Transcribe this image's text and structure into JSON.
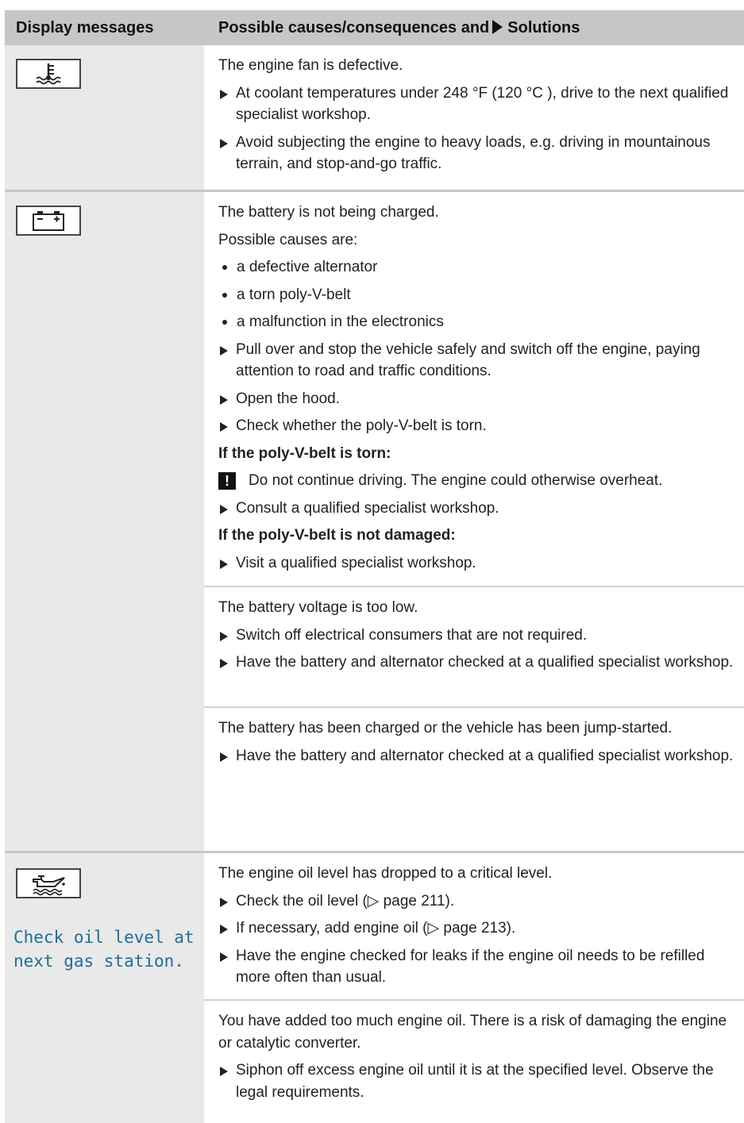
{
  "header": {
    "col1": "Display messages",
    "col2": "Possible causes/consequences and",
    "col2_solutions": "Solutions"
  },
  "icons": {
    "coolant": "coolant-temperature-icon",
    "battery": "battery-icon",
    "oil": "oil-can-icon"
  },
  "rows": {
    "fan": {
      "text": "The engine fan is defective.",
      "b1": "At coolant temperatures under 248 °F (120 °C ), drive to the next qualified specialist workshop.",
      "b2": "Avoid subjecting the engine to heavy loads, e.g. driving in mountainous terrain, and stop-and-go traffic."
    },
    "battery": {
      "text": "The battery is not being charged.",
      "causes": "Possible causes are:",
      "d1": "a defective alternator",
      "d2": "a torn poly-V-belt",
      "d3": "a malfunction in the electronics",
      "b1": "Pull over and stop the vehicle safely and switch off the engine, paying attention to road and traffic conditions.",
      "b2": "Open the hood.",
      "b3": "Check whether the poly-V-belt is torn.",
      "torn_heading": "If the poly-V-belt is torn:",
      "warning_mark": "!",
      "warning": "Do not continue driving. The engine could otherwise overheat.",
      "b4": "Consult a qualified specialist workshop.",
      "not_damaged_heading": "If the poly-V-belt is not damaged:",
      "b5": "Visit a qualified specialist workshop."
    },
    "voltage": {
      "text": "The battery voltage is too low.",
      "b1": "Switch off electrical consumers that are not required.",
      "b2": "Have the battery and alternator checked at a qualified specialist workshop."
    },
    "charged": {
      "text": "The battery has been charged or the vehicle has been jump-started.",
      "b1": "Have the battery and alternator checked at a qualified specialist workshop."
    },
    "oil_low": {
      "display": "Check oil level at\nnext gas station.",
      "text": "The engine oil level has dropped to a critical level.",
      "b1": "Check the oil level (▷ page 211).",
      "b2": "If necessary, add engine oil (▷ page 213).",
      "b3": "Have the engine checked for leaks if the engine oil needs to be refilled more often than usual."
    },
    "oil_high": {
      "text": "You have added too much engine oil. There is a risk of damaging the engine or catalytic converter.",
      "b1": "Siphon off excess engine oil until it is at the specified level. Observe the legal requirements."
    }
  }
}
